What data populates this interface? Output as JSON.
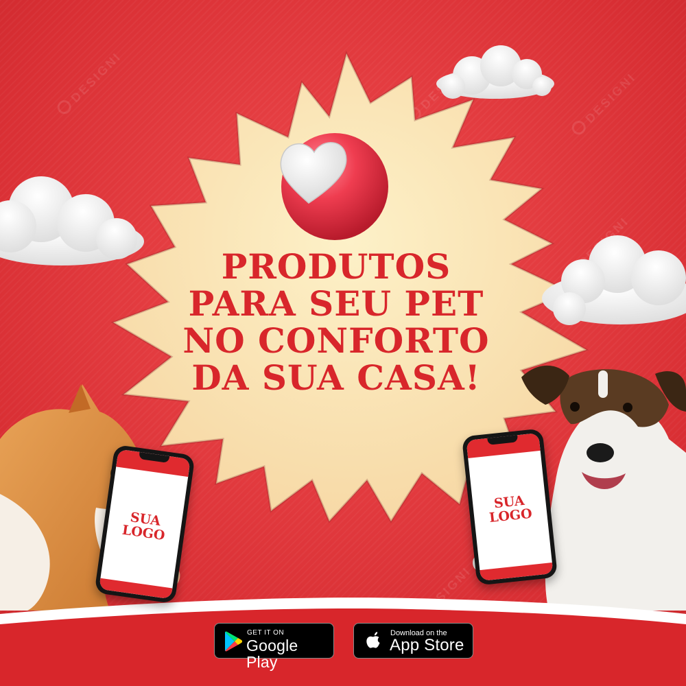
{
  "headline": {
    "line1": "PRODUTOS",
    "line2": "PARA SEU PET",
    "line3": "NO CONFORTO",
    "line4": "DA SUA CASA!"
  },
  "phones": {
    "left_logo_line1": "SUA",
    "left_logo_line2": "LOGO",
    "right_logo_line1": "SUA",
    "right_logo_line2": "LOGO"
  },
  "store_buttons": {
    "google_small": "GET IT ON",
    "google_big": "Google Play",
    "apple_small": "Download on the",
    "apple_big": "App Store"
  },
  "watermark": "DESIGNI",
  "colors": {
    "background": "#e23a3e",
    "burst": "#fbe3b4",
    "headline": "#d8262b",
    "heart_ball": "#ee3b4c",
    "button": "#000000"
  },
  "icons": [
    "heart-icon",
    "google-play-icon",
    "apple-icon"
  ]
}
